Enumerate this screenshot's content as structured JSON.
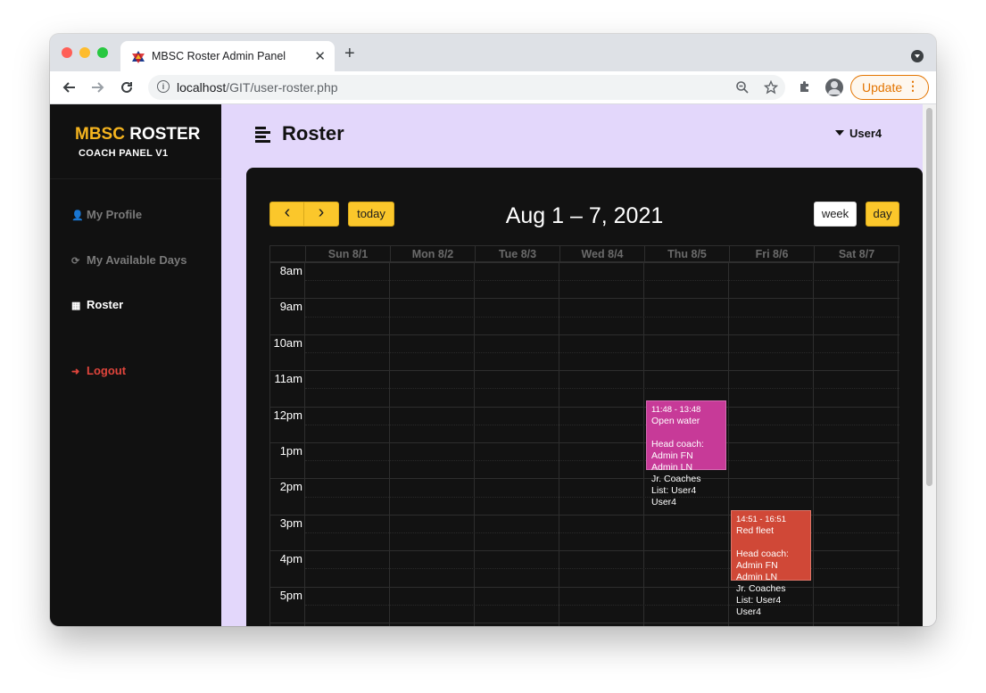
{
  "browser": {
    "tab_title": "MBSC Roster Admin Panel",
    "tab_close": "✕",
    "new_tab": "+",
    "url_host": "localhost",
    "url_path": "/GIT/user-roster.php",
    "update_label": "Update",
    "update_menu": "⋮"
  },
  "sidebar": {
    "brand_accent": "MBSC",
    "brand_rest": " ROSTER",
    "subtitle": "COACH PANEL V1",
    "items": [
      {
        "label": "My Profile",
        "icon": "user-icon",
        "glyph": "👤"
      },
      {
        "label": "My Available Days",
        "icon": "refresh-icon",
        "glyph": "⟳"
      },
      {
        "label": "Roster",
        "icon": "calendar-icon",
        "glyph": "▦"
      },
      {
        "label": "Logout",
        "icon": "logout-icon",
        "glyph": "➜"
      }
    ]
  },
  "header": {
    "title": "Roster",
    "user": "User4"
  },
  "calendar": {
    "prev": "‹",
    "next": "›",
    "today": "today",
    "title": "Aug 1 – 7, 2021",
    "view_week": "week",
    "view_day": "day",
    "days": [
      "Sun 8/1",
      "Mon 8/2",
      "Tue 8/3",
      "Wed 8/4",
      "Thu 8/5",
      "Fri 8/6",
      "Sat 8/7"
    ],
    "hours": [
      "8am",
      "9am",
      "10am",
      "11am",
      "12pm",
      "1pm",
      "2pm",
      "3pm",
      "4pm",
      "5pm"
    ],
    "events": [
      {
        "time": "11:48 - 13:48",
        "body": "Open water\n\nHead coach:\nAdmin FN\nAdmin LN\nJr. Coaches\nList: User4\nUser4",
        "color": "#c73a98"
      },
      {
        "time": "14:51 - 16:51",
        "body": "Red fleet\n\nHead coach:\nAdmin FN\nAdmin LN\nJr. Coaches\nList: User4\nUser4",
        "color": "#d04837"
      }
    ]
  },
  "colors": {
    "accent": "#fbc72b",
    "sidebar_bg": "#111111",
    "page_bg": "#e3d7fb"
  }
}
